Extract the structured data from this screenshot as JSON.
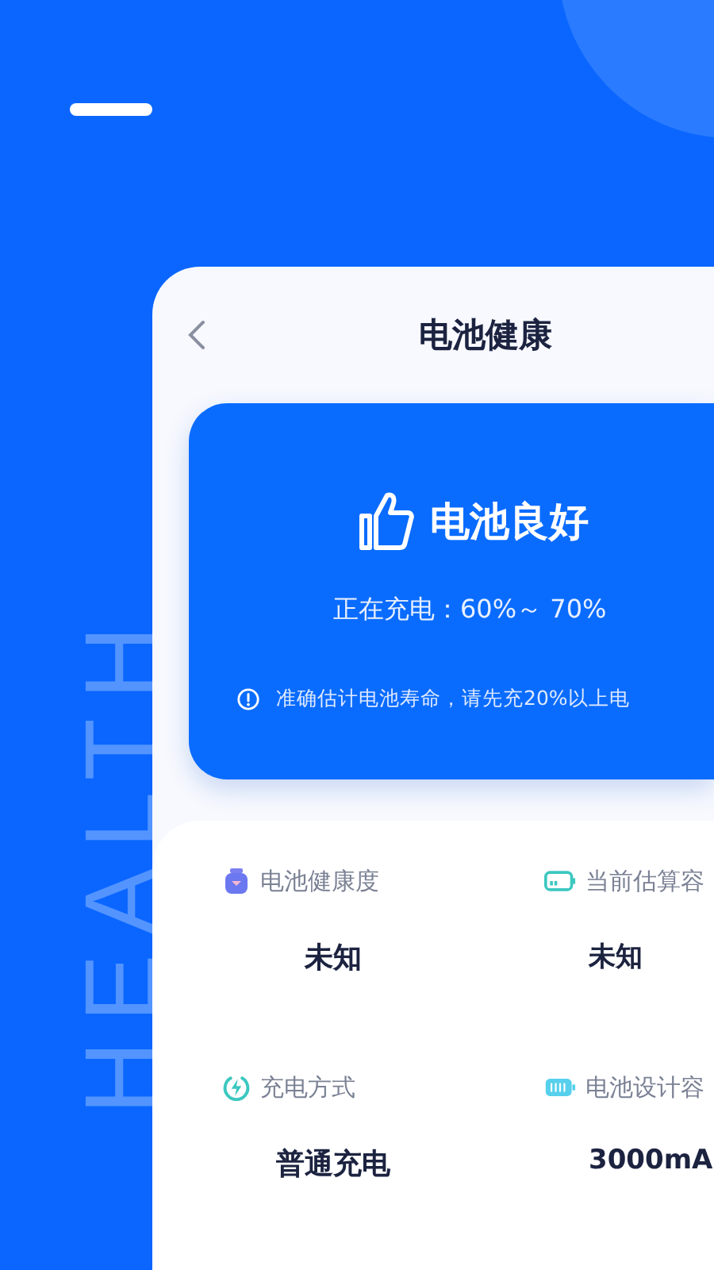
{
  "backdrop_word": "HEALTH",
  "screen": {
    "title": "电池健康",
    "status_card": {
      "headline": "电池良好",
      "charging": "正在充电：60%～ 70%",
      "notice": "准确估计电池寿命，请先充20%以上电"
    },
    "stats": [
      {
        "kind": "health",
        "label": "电池健康度",
        "value": "未知"
      },
      {
        "kind": "estimate",
        "label": "当前估算容",
        "value": "未知"
      },
      {
        "kind": "charge",
        "label": "充电方式",
        "value": "普通充电"
      },
      {
        "kind": "design",
        "label": "电池设计容",
        "value": "3000mA"
      }
    ]
  }
}
